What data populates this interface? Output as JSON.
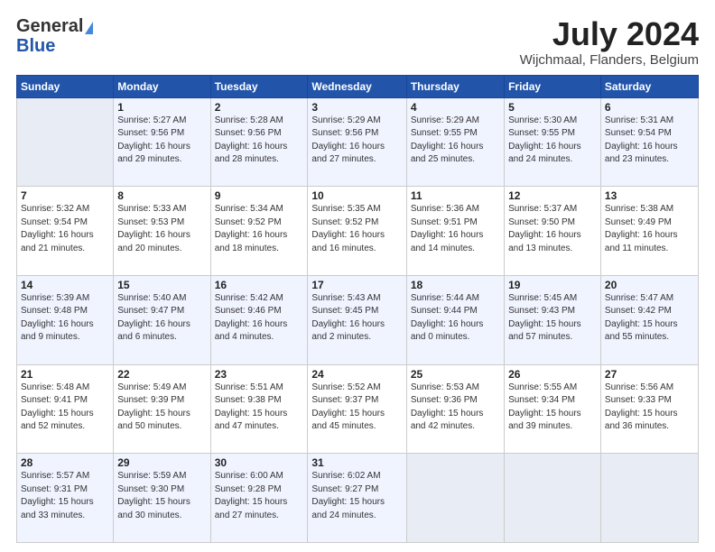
{
  "header": {
    "logo_general": "General",
    "logo_blue": "Blue",
    "month_title": "July 2024",
    "location": "Wijchmaal, Flanders, Belgium"
  },
  "days_of_week": [
    "Sunday",
    "Monday",
    "Tuesday",
    "Wednesday",
    "Thursday",
    "Friday",
    "Saturday"
  ],
  "weeks": [
    [
      {
        "day": "",
        "empty": true
      },
      {
        "day": "1",
        "sunrise": "5:27 AM",
        "sunset": "9:56 PM",
        "daylight": "16 hours and 29 minutes."
      },
      {
        "day": "2",
        "sunrise": "5:28 AM",
        "sunset": "9:56 PM",
        "daylight": "16 hours and 28 minutes."
      },
      {
        "day": "3",
        "sunrise": "5:29 AM",
        "sunset": "9:56 PM",
        "daylight": "16 hours and 27 minutes."
      },
      {
        "day": "4",
        "sunrise": "5:29 AM",
        "sunset": "9:55 PM",
        "daylight": "16 hours and 25 minutes."
      },
      {
        "day": "5",
        "sunrise": "5:30 AM",
        "sunset": "9:55 PM",
        "daylight": "16 hours and 24 minutes."
      },
      {
        "day": "6",
        "sunrise": "5:31 AM",
        "sunset": "9:54 PM",
        "daylight": "16 hours and 23 minutes."
      }
    ],
    [
      {
        "day": "7",
        "sunrise": "5:32 AM",
        "sunset": "9:54 PM",
        "daylight": "16 hours and 21 minutes."
      },
      {
        "day": "8",
        "sunrise": "5:33 AM",
        "sunset": "9:53 PM",
        "daylight": "16 hours and 20 minutes."
      },
      {
        "day": "9",
        "sunrise": "5:34 AM",
        "sunset": "9:52 PM",
        "daylight": "16 hours and 18 minutes."
      },
      {
        "day": "10",
        "sunrise": "5:35 AM",
        "sunset": "9:52 PM",
        "daylight": "16 hours and 16 minutes."
      },
      {
        "day": "11",
        "sunrise": "5:36 AM",
        "sunset": "9:51 PM",
        "daylight": "16 hours and 14 minutes."
      },
      {
        "day": "12",
        "sunrise": "5:37 AM",
        "sunset": "9:50 PM",
        "daylight": "16 hours and 13 minutes."
      },
      {
        "day": "13",
        "sunrise": "5:38 AM",
        "sunset": "9:49 PM",
        "daylight": "16 hours and 11 minutes."
      }
    ],
    [
      {
        "day": "14",
        "sunrise": "5:39 AM",
        "sunset": "9:48 PM",
        "daylight": "16 hours and 9 minutes."
      },
      {
        "day": "15",
        "sunrise": "5:40 AM",
        "sunset": "9:47 PM",
        "daylight": "16 hours and 6 minutes."
      },
      {
        "day": "16",
        "sunrise": "5:42 AM",
        "sunset": "9:46 PM",
        "daylight": "16 hours and 4 minutes."
      },
      {
        "day": "17",
        "sunrise": "5:43 AM",
        "sunset": "9:45 PM",
        "daylight": "16 hours and 2 minutes."
      },
      {
        "day": "18",
        "sunrise": "5:44 AM",
        "sunset": "9:44 PM",
        "daylight": "16 hours and 0 minutes."
      },
      {
        "day": "19",
        "sunrise": "5:45 AM",
        "sunset": "9:43 PM",
        "daylight": "15 hours and 57 minutes."
      },
      {
        "day": "20",
        "sunrise": "5:47 AM",
        "sunset": "9:42 PM",
        "daylight": "15 hours and 55 minutes."
      }
    ],
    [
      {
        "day": "21",
        "sunrise": "5:48 AM",
        "sunset": "9:41 PM",
        "daylight": "15 hours and 52 minutes."
      },
      {
        "day": "22",
        "sunrise": "5:49 AM",
        "sunset": "9:39 PM",
        "daylight": "15 hours and 50 minutes."
      },
      {
        "day": "23",
        "sunrise": "5:51 AM",
        "sunset": "9:38 PM",
        "daylight": "15 hours and 47 minutes."
      },
      {
        "day": "24",
        "sunrise": "5:52 AM",
        "sunset": "9:37 PM",
        "daylight": "15 hours and 45 minutes."
      },
      {
        "day": "25",
        "sunrise": "5:53 AM",
        "sunset": "9:36 PM",
        "daylight": "15 hours and 42 minutes."
      },
      {
        "day": "26",
        "sunrise": "5:55 AM",
        "sunset": "9:34 PM",
        "daylight": "15 hours and 39 minutes."
      },
      {
        "day": "27",
        "sunrise": "5:56 AM",
        "sunset": "9:33 PM",
        "daylight": "15 hours and 36 minutes."
      }
    ],
    [
      {
        "day": "28",
        "sunrise": "5:57 AM",
        "sunset": "9:31 PM",
        "daylight": "15 hours and 33 minutes."
      },
      {
        "day": "29",
        "sunrise": "5:59 AM",
        "sunset": "9:30 PM",
        "daylight": "15 hours and 30 minutes."
      },
      {
        "day": "30",
        "sunrise": "6:00 AM",
        "sunset": "9:28 PM",
        "daylight": "15 hours and 27 minutes."
      },
      {
        "day": "31",
        "sunrise": "6:02 AM",
        "sunset": "9:27 PM",
        "daylight": "15 hours and 24 minutes."
      },
      {
        "day": "",
        "empty": true
      },
      {
        "day": "",
        "empty": true
      },
      {
        "day": "",
        "empty": true
      }
    ]
  ]
}
